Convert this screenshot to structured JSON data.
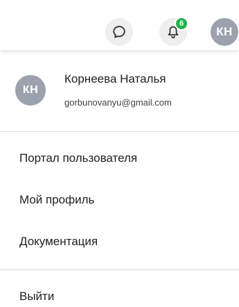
{
  "topbar": {
    "chat_icon": "chat-bubble-icon",
    "bell_icon": "bell-icon",
    "notifications_count": "6",
    "avatar_initials": "КН",
    "badge_color": "#24b04b",
    "avatar_color": "#9ba1ad"
  },
  "user_menu": {
    "avatar_initials": "КН",
    "name": "Корнеева Наталья",
    "email": "gorbunovanyu@gmail.com",
    "items": [
      {
        "label": "Портал пользователя"
      },
      {
        "label": "Мой профиль"
      },
      {
        "label": "Документация"
      },
      {
        "label": "Выйти"
      }
    ]
  }
}
